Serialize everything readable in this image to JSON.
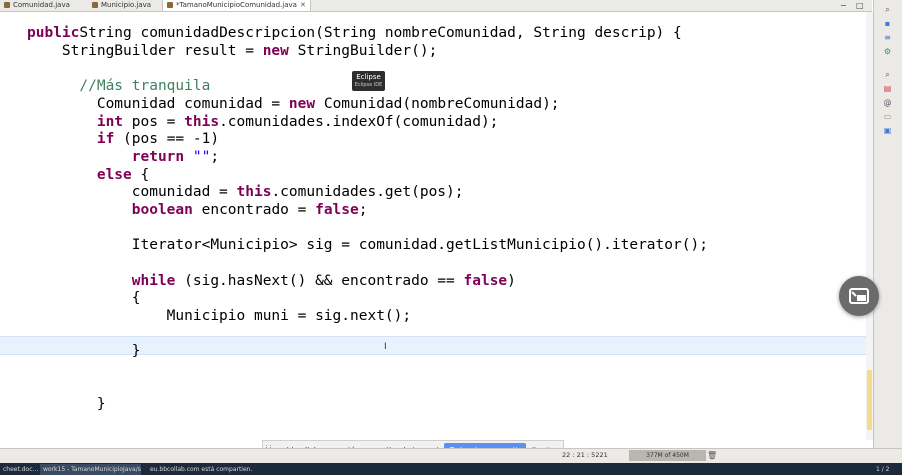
{
  "tabs": [
    {
      "label": "Comunidad.java",
      "active": false
    },
    {
      "label": "Municipio.java",
      "active": false
    },
    {
      "label": "*TamanoMunicipioComunidad.java",
      "active": true
    }
  ],
  "window": {
    "minimize": "−",
    "maximize": "□"
  },
  "code": [
    [
      [
        "kw",
        "public"
      ],
      [
        "",
        "String comunidadDescripcion(String nombreComunidad, String descrip) {"
      ]
    ],
    [
      [
        "",
        "    StringBuilder result = "
      ],
      [
        "kw",
        "new"
      ],
      [
        "",
        " StringBuilder();"
      ]
    ],
    [],
    [
      [
        "cm",
        "      //Más tranquila"
      ]
    ],
    [
      [
        "",
        "        Comunidad comunidad = "
      ],
      [
        "kw",
        "new"
      ],
      [
        "",
        " Comunidad(nombreComunidad);"
      ]
    ],
    [
      [
        "kw",
        "        int"
      ],
      [
        "",
        " pos = "
      ],
      [
        "kw",
        "this"
      ],
      [
        "",
        ".comunidades.indexOf(comunidad);"
      ]
    ],
    [
      [
        "kw",
        "        if"
      ],
      [
        "",
        " (pos == -1)"
      ]
    ],
    [
      [
        "kw",
        "            return"
      ],
      [
        "",
        " "
      ],
      [
        "st",
        "\"\""
      ],
      [
        "",
        ";"
      ]
    ],
    [
      [
        "kw",
        "        else"
      ],
      [
        "",
        " {"
      ]
    ],
    [
      [
        "",
        "            comunidad = "
      ],
      [
        "kw",
        "this"
      ],
      [
        "",
        ".comunidades.get(pos);"
      ]
    ],
    [
      [
        "kw",
        "            boolean"
      ],
      [
        "",
        " encontrado = "
      ],
      [
        "kw",
        "false"
      ],
      [
        "",
        ";"
      ]
    ],
    [],
    [
      [
        "",
        "            Iterator<Municipio> sig = comunidad.getListMunicipio().iterator();"
      ]
    ],
    [],
    [
      [
        "kw",
        "            while"
      ],
      [
        "",
        " (sig.hasNext() && encontrado == "
      ],
      [
        "kw",
        "false"
      ],
      [
        "",
        ")"
      ]
    ],
    [
      [
        "",
        "            {"
      ]
    ],
    [
      [
        "",
        "                Municipio muni = sig.next();"
      ]
    ],
    [],
    [
      [
        "",
        "            }"
      ]
    ],
    [],
    [],
    [
      [
        "",
        "        }"
      ]
    ]
  ],
  "tooltip": {
    "title": "Eclipse",
    "subtitle": "Eclipse IDE"
  },
  "share_banner": {
    "message": "eu.bbcollab.com está compartiendo tu pantalla.",
    "stop_label": "Dejar de compartir",
    "hide_label": "Ocultar"
  },
  "status": {
    "cursor_position": "22 : 21 : 5221",
    "memory": "377M of 450M"
  },
  "taskbar": {
    "items": [
      {
        "label": "cheet.doc..."
      },
      {
        "label": "work15 - TamanoMunicipioJava/src/..."
      },
      {
        "label": "eu.bbcollab.com está compartien..."
      }
    ],
    "pager": "1 / 2"
  },
  "accent_colors": {
    "keyword": "#7f0055",
    "comment": "#3f7f5f",
    "string": "#2a00ff",
    "share_button": "#5b8ff4"
  }
}
